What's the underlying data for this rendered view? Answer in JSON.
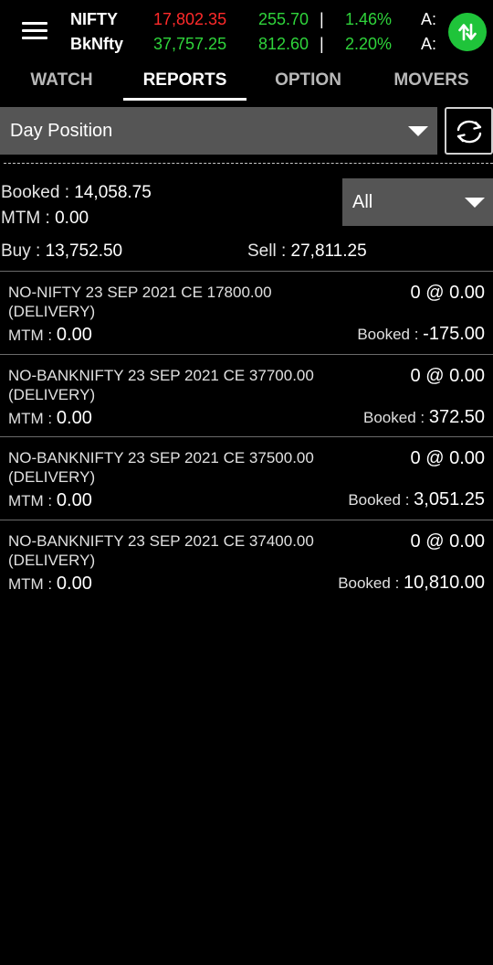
{
  "ticker": [
    {
      "name": "NIFTY",
      "price": "17,802.35",
      "price_color": "#ff2a2a",
      "change": "255.70",
      "sep": "|",
      "pct": "1.46%",
      "a_label": "A:"
    },
    {
      "name": "BkNfty",
      "price": "37,757.25",
      "price_color": "#2fd43b",
      "change": "812.60",
      "sep": "|",
      "pct": "2.20%",
      "a_label": "A:"
    }
  ],
  "tabs": [
    "WATCH",
    "REPORTS",
    "OPTION",
    "MOVERS"
  ],
  "active_tab": "REPORTS",
  "position_type": {
    "selected": "Day Position"
  },
  "summary": {
    "booked_label": "Booked : ",
    "booked_value": "14,058.75",
    "mtm_label": "MTM : ",
    "mtm_value": "0.00",
    "buy_label": "Buy : ",
    "buy_value": "13,752.50",
    "sell_label": "Sell : ",
    "sell_value": "27,811.25"
  },
  "filter": {
    "selected": "All"
  },
  "positions": [
    {
      "symbol": "NO-NIFTY 23 SEP 2021 CE 17800.00 (DELIVERY)",
      "qty": "0 @ 0.00",
      "mtm_label": "MTM : ",
      "mtm": "0.00",
      "booked_label": "Booked : ",
      "booked": "-175.00"
    },
    {
      "symbol": "NO-BANKNIFTY 23 SEP 2021 CE 37700.00 (DELIVERY)",
      "qty": "0 @ 0.00",
      "mtm_label": "MTM : ",
      "mtm": "0.00",
      "booked_label": "Booked : ",
      "booked": "372.50"
    },
    {
      "symbol": "NO-BANKNIFTY 23 SEP 2021 CE 37500.00 (DELIVERY)",
      "qty": "0 @ 0.00",
      "mtm_label": "MTM : ",
      "mtm": "0.00",
      "booked_label": "Booked : ",
      "booked": "3,051.25"
    },
    {
      "symbol": "NO-BANKNIFTY 23 SEP 2021 CE 37400.00 (DELIVERY)",
      "qty": "0 @ 0.00",
      "mtm_label": "MTM : ",
      "mtm": "0.00",
      "booked_label": "Booked : ",
      "booked": "10,810.00"
    }
  ],
  "colors": {
    "accent_green": "#2fd43b",
    "negative_red": "#ff2a2a",
    "dropdown_bg": "#555555"
  },
  "icons": {
    "menu": "hamburger-icon",
    "updown": "up-down-arrows-icon",
    "refresh": "refresh-icon",
    "dropdown": "caret-down-icon"
  }
}
